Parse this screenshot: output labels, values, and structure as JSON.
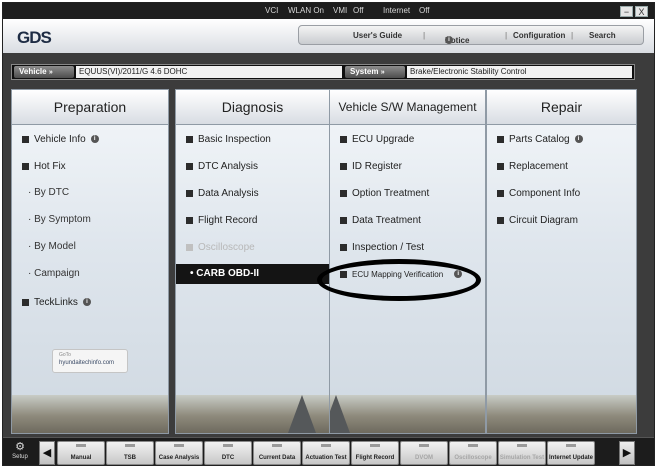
{
  "statusbar": {
    "vci": "VCI",
    "wlan": "WLAN On",
    "vmi": "VMI",
    "vmi_state": "Off",
    "internet": "Internet",
    "internet_state": "Off",
    "minimize": "−",
    "close": "X"
  },
  "header": {
    "logo": "GDS",
    "menu": [
      "User's Guide",
      "Notice",
      "Configuration",
      "Search"
    ]
  },
  "vehicle_bar": {
    "vehicle_label": "Vehicle",
    "vehicle_value": "EQUUS(VI)/2011/G 4.6 DOHC",
    "system_label": "System",
    "system_value": "Brake/Electronic Stability Control"
  },
  "columns": {
    "preparation": {
      "title": "Preparation",
      "items": [
        "Vehicle Info",
        "Hot Fix",
        "By DTC",
        "By Symptom",
        "By Model",
        "Campaign",
        "TeckLinks"
      ],
      "logo_small": "GoTo",
      "logo_text": "hyundaitechinfo.com"
    },
    "diagnosis": {
      "title": "Diagnosis",
      "items": [
        "Basic Inspection",
        "DTC Analysis",
        "Data Analysis",
        "Flight Record",
        "Oscilloscope",
        "CARB OBD-II"
      ]
    },
    "vehicle_sw": {
      "title": "Vehicle S/W Management",
      "items": [
        "ECU Upgrade",
        "ID Register",
        "Option Treatment",
        "Data Treatment",
        "Inspection / Test",
        "ECU Mapping Verification"
      ]
    },
    "repair": {
      "title": "Repair",
      "items": [
        "Parts Catalog",
        "Replacement",
        "Component Info",
        "Circuit Diagram"
      ]
    }
  },
  "bottombar": {
    "setup": "Setup",
    "buttons": [
      {
        "label": "Manual",
        "enabled": true
      },
      {
        "label": "TSB",
        "enabled": true
      },
      {
        "label": "Case Analysis",
        "enabled": true
      },
      {
        "label": "DTC",
        "enabled": true
      },
      {
        "label": "Current Data",
        "enabled": true
      },
      {
        "label": "Actuation Test",
        "enabled": true
      },
      {
        "label": "Flight Record",
        "enabled": true
      },
      {
        "label": "DVOM",
        "enabled": false
      },
      {
        "label": "Oscilloscope",
        "enabled": false
      },
      {
        "label": "Simulation Test",
        "enabled": false
      },
      {
        "label": "Internet Update",
        "enabled": true
      }
    ]
  },
  "colors": {
    "frame": "#3c3c3c",
    "panel": "#dfe6ed",
    "selected": "#141414",
    "annotation": "#000000"
  }
}
